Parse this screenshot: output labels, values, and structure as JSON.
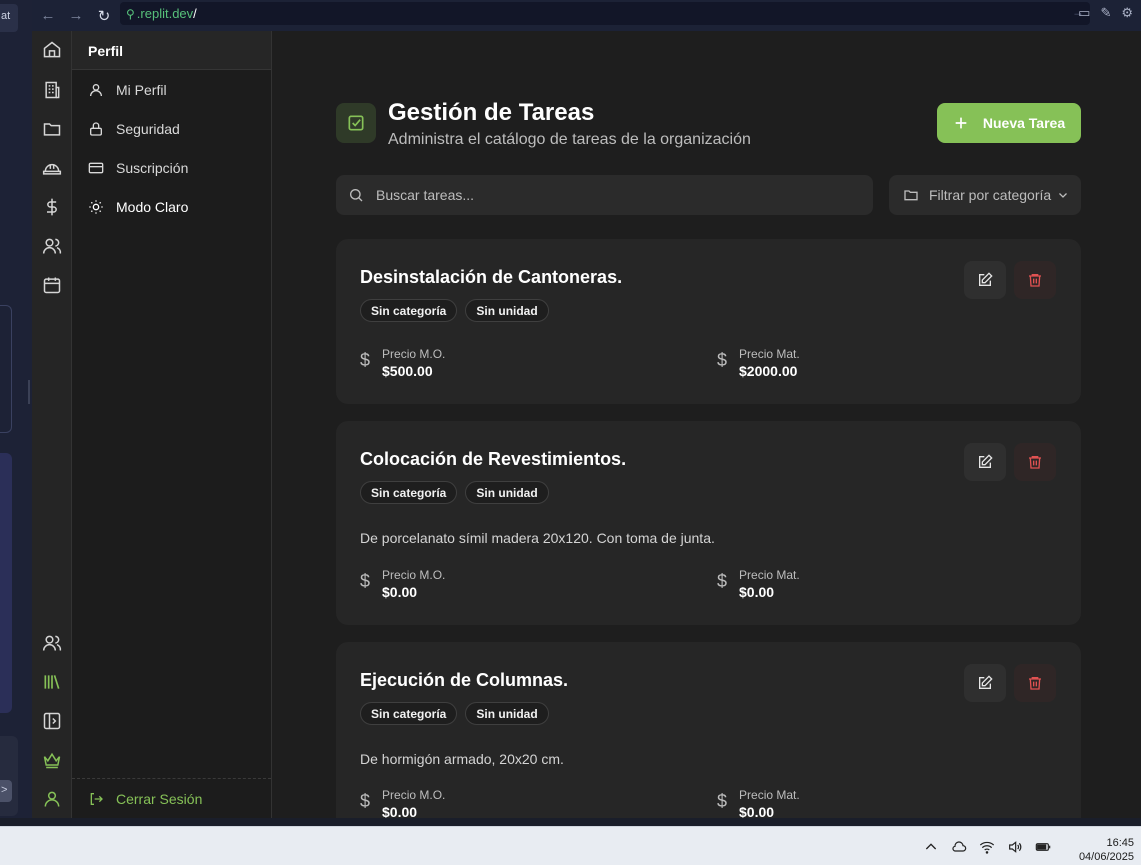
{
  "browser": {
    "url_host": ".replit.dev",
    "url_path": "/",
    "left_tab_fragment": "at"
  },
  "side_panel": {
    "header": "Perfil",
    "items": [
      {
        "label": "Mi Perfil",
        "icon": "user-icon"
      },
      {
        "label": "Seguridad",
        "icon": "lock-icon"
      },
      {
        "label": "Suscripción",
        "icon": "credit-card-icon"
      },
      {
        "label": "Modo Claro",
        "icon": "sun-icon"
      }
    ],
    "logout_label": "Cerrar Sesión"
  },
  "rail_icons_top": [
    "home-icon",
    "building-icon",
    "folder-icon",
    "hard-hat-icon",
    "dollar-icon",
    "users-icon",
    "calendar-icon"
  ],
  "rail_icons_bottom": [
    "users-icon",
    "library-icon",
    "panel-icon",
    "crown-icon",
    "user-icon"
  ],
  "page": {
    "title": "Gestión de Tareas",
    "subtitle": "Administra el catálogo de tareas de la organización",
    "new_button_label": "Nueva Tarea",
    "search_placeholder": "Buscar tareas...",
    "filter_label": "Filtrar por categoría"
  },
  "tasks": [
    {
      "title": "Desinstalación de Cantoneras.",
      "tags": [
        "Sin categoría",
        "Sin unidad"
      ],
      "description": "",
      "labor_label": "Precio M.O.",
      "labor_value": "$500.00",
      "material_label": "Precio Mat.",
      "material_value": "$2000.00"
    },
    {
      "title": "Colocación de Revestimientos.",
      "tags": [
        "Sin categoría",
        "Sin unidad"
      ],
      "description": "De porcelanato símil madera 20x120. Con toma de junta.",
      "labor_label": "Precio M.O.",
      "labor_value": "$0.00",
      "material_label": "Precio Mat.",
      "material_value": "$0.00"
    },
    {
      "title": "Ejecución de Columnas.",
      "tags": [
        "Sin categoría",
        "Sin unidad"
      ],
      "description": "De hormigón armado, 20x20 cm.",
      "labor_label": "Precio M.O.",
      "labor_value": "$0.00",
      "material_label": "Precio Mat.",
      "material_value": "$0.00"
    }
  ],
  "taskbar": {
    "time": "16:45",
    "date": "04/06/2025"
  },
  "colors": {
    "accent": "#86c157",
    "background": "#1e1e1e",
    "card": "#262626",
    "delete": "#e05252"
  }
}
